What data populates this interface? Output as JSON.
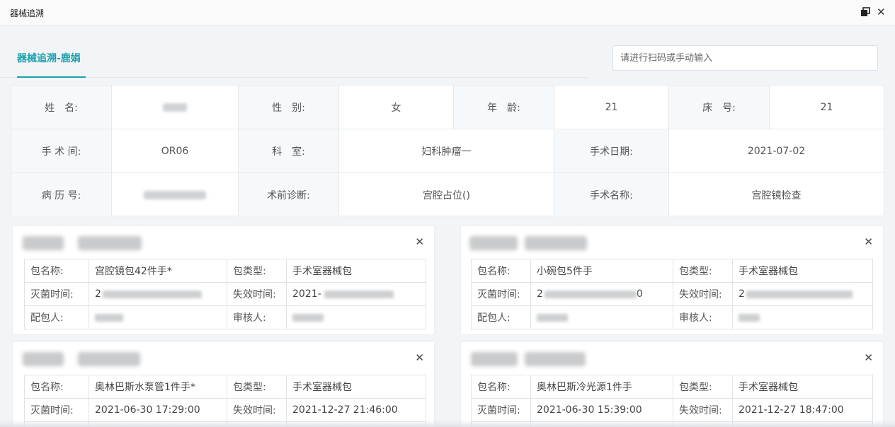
{
  "window": {
    "title": "器械追溯",
    "restore_icon": "restore-window-icon",
    "close_icon": "close-icon"
  },
  "tab": {
    "active_label": "器械追溯-鹿娟"
  },
  "search": {
    "placeholder": "请进行扫码或手动输入",
    "value": ""
  },
  "patient": {
    "name_label": "姓　名:",
    "name_value": "",
    "gender_label": "性　别:",
    "gender_value": "女",
    "age_label": "年　龄:",
    "age_value": "21",
    "bed_label": "床　号:",
    "bed_value": "21",
    "room_label": "手 术 间:",
    "room_value": "OR06",
    "dept_label": "科　室:",
    "dept_value": "妇科肿瘤一",
    "date_label": "手术日期:",
    "date_value": "2021-07-02",
    "record_label": "病 历 号:",
    "record_value": "",
    "diag_label": "术前诊断:",
    "diag_value": "宫腔占位()",
    "surgery_label": "手术名称:",
    "surgery_value": "宫腔镜检查"
  },
  "labels": {
    "pkg_name": "包名称:",
    "pkg_type": "包类型:",
    "sterilize_time": "灭菌时间:",
    "expire_time": "失效时间:",
    "packer": "配包人:",
    "reviewer": "审核人:"
  },
  "cards": [
    {
      "pkg_name": "宫腔镜包42件手*",
      "pkg_type": "手术室器械包",
      "sterilize_time": "2",
      "expire_time": "2021-",
      "packer": "",
      "reviewer": ""
    },
    {
      "pkg_name": "小碗包5件手",
      "pkg_type": "手术室器械包",
      "sterilize_time": "2",
      "sterilize_time_tail": "0",
      "expire_time": "2",
      "packer": "",
      "reviewer": ""
    },
    {
      "pkg_name": "奥林巴斯水泵管1件手*",
      "pkg_type": "手术室器械包",
      "sterilize_time": "2021-06-30 17:29:00",
      "expire_time": "2021-12-27 21:46:00"
    },
    {
      "pkg_name": "奥林巴斯冷光源1件手",
      "pkg_type": "手术室器械包",
      "sterilize_time": "2021-06-30 15:39:00",
      "expire_time": "2021-12-27 18:47:00"
    }
  ],
  "card_close_icon": "close-icon"
}
